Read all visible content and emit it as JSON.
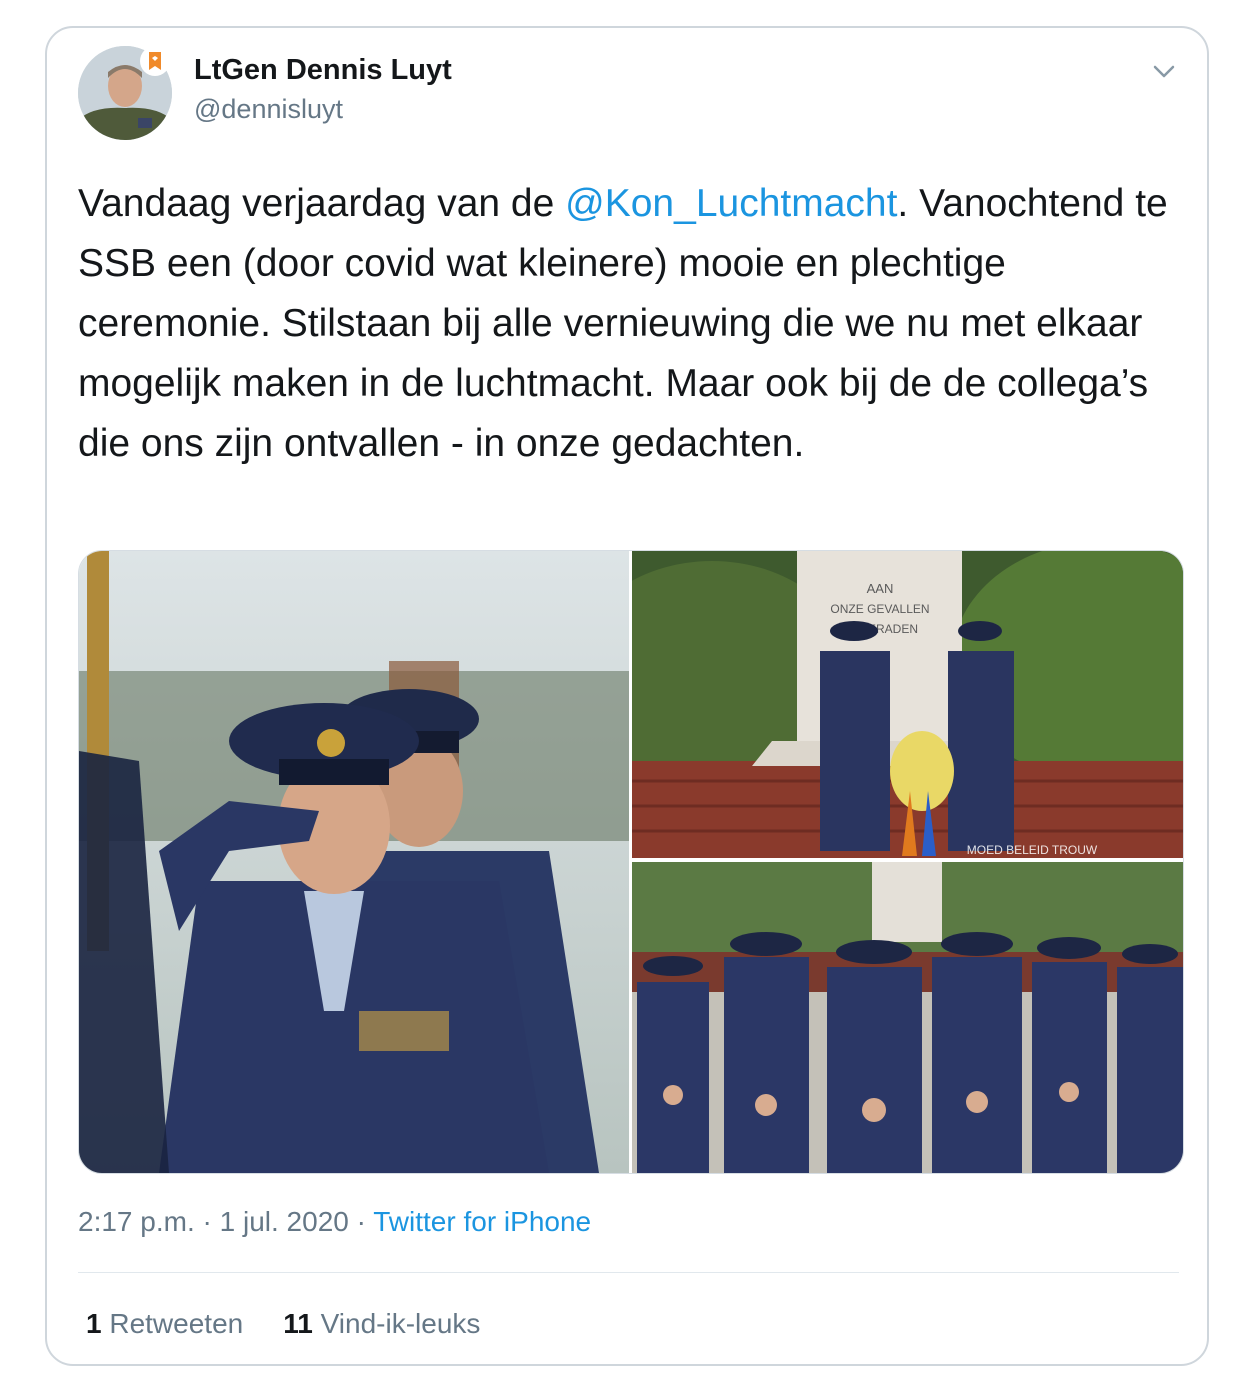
{
  "tweet": {
    "author_name": "LtGen Dennis Luyt",
    "handle": "@dennisluyt",
    "text_before": "Vandaag verjaardag van de ",
    "mention": "@Kon_Luchtmacht",
    "text_after": ". Vanochtend te SSB een (door covid wat kleinere) mooie en plechtige ceremonie. Stilstaan bij alle vernieuwing die we nu met elkaar mogelijk maken in de luchtmacht. Maar ook bij de de collega’s die ons zijn ontvallen - in onze gedachten.",
    "time": "2:17 p.m.",
    "separator": "·",
    "date": "1 jul. 2020",
    "source": "Twitter for iPhone"
  },
  "photos": {
    "memorial_text": [
      "AAN",
      "ONZE GEVALLEN",
      "KAMERADEN"
    ],
    "watermark": "MOED BELEID TROUW"
  },
  "stats": {
    "retweets_count": "1",
    "retweets_label": "Retweeten",
    "likes_count": "11",
    "likes_label": "Vind-ik-leuks"
  },
  "icons": [
    "chevron-down-icon"
  ],
  "colors": {
    "link": "#1b95e0",
    "secondary": "#657786",
    "border": "#cfd6dc"
  }
}
